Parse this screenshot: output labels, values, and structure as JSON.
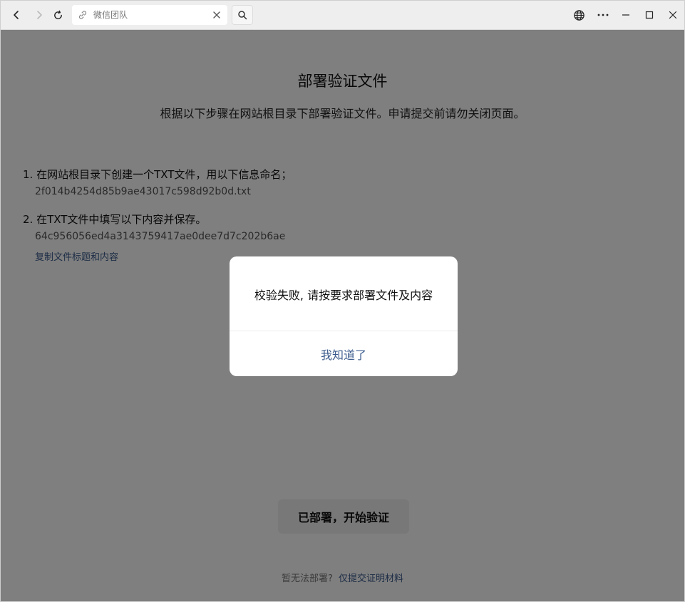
{
  "browser": {
    "address_title": "微信团队"
  },
  "page": {
    "title": "部署验证文件",
    "subtitle": "根据以下步骤在网站根目录下部署验证文件。申请提交前请勿关闭页面。",
    "steps": [
      {
        "label": "1. 在网站根目录下创建一个TXT文件，用以下信息命名；",
        "value": "2f014b4254d85b9ae43017c598d92b0d.txt"
      },
      {
        "label": "2. 在TXT文件中填写以下内容并保存。",
        "value": "64c956056ed4a3143759417ae0dee7d7c202b6ae"
      }
    ],
    "copy_link": "复制文件标题和内容",
    "verify_button": "已部署，开始验证",
    "footer_text": "暂无法部署?",
    "footer_link": "仅提交证明材料"
  },
  "dialog": {
    "message": "校验失败, 请按要求部署文件及内容",
    "button": "我知道了"
  },
  "colors": {
    "link": "#3a5a8c",
    "mask": "rgba(0,0,0,0.5)"
  }
}
